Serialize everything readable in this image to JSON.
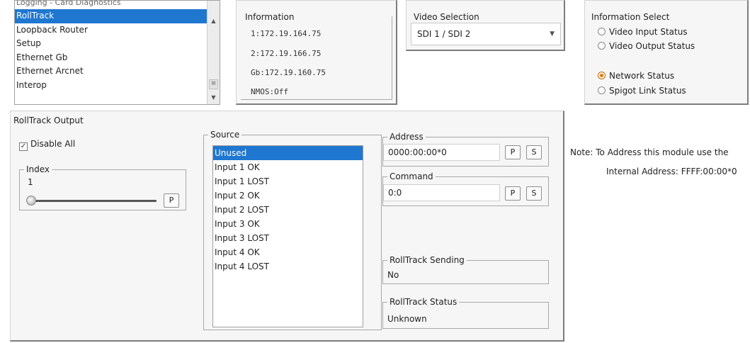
{
  "top_list": {
    "items": [
      {
        "label": "Logging - Card Diagnostics",
        "state": "cut"
      },
      {
        "label": "RollTrack",
        "state": "selected"
      },
      {
        "label": "Loopback Router",
        "state": ""
      },
      {
        "label": "Setup",
        "state": ""
      },
      {
        "label": "Ethernet Gb",
        "state": ""
      },
      {
        "label": "Ethernet Arcnet",
        "state": ""
      },
      {
        "label": "Interop",
        "state": ""
      }
    ],
    "scroll_up": "▲",
    "scroll_down": "▼",
    "grip": "≡"
  },
  "information": {
    "title": "Information",
    "lines": [
      "1:172.19.164.75",
      "2:172.19.166.75",
      "Gb:172.19.160.75",
      "NMOS:Off"
    ]
  },
  "video_selection": {
    "title": "Video Selection",
    "value": "SDI 1 / SDI 2",
    "caret": "▼"
  },
  "information_select": {
    "title": "Information Select",
    "options": [
      {
        "label": "Video Input Status",
        "selected": false
      },
      {
        "label": "Video Output Status",
        "selected": false
      },
      {
        "label": "Network Status",
        "selected": true
      },
      {
        "label": "Spigot Link Status",
        "selected": false
      }
    ]
  },
  "rolltrack_output": {
    "title": "RollTrack Output",
    "disable_all": {
      "label": "Disable All",
      "checked": true,
      "mark": "✓"
    },
    "index": {
      "title": "Index",
      "value": "1",
      "button": "P"
    },
    "source": {
      "title": "Source",
      "items": [
        "Unused",
        "Input 1 OK",
        "Input 1 LOST",
        "Input 2 OK",
        "Input 2 LOST",
        "Input 3 OK",
        "Input 3 LOST",
        "Input 4 OK",
        "Input 4 LOST"
      ],
      "selected_index": 0
    },
    "address": {
      "title": "Address",
      "value": "0000:00:00*0",
      "btn_p": "P",
      "btn_s": "S"
    },
    "command": {
      "title": "Command",
      "value": "0:0",
      "btn_p": "P",
      "btn_s": "S"
    },
    "sending": {
      "title": "RollTrack Sending",
      "value": "No"
    },
    "status": {
      "title": "RollTrack Status",
      "value": "Unknown"
    }
  },
  "note": {
    "line1": "Note: To Address this module use the",
    "line2": "Internal Address: FFFF:00:00*0"
  },
  "colors": {
    "selection": "#1f77d0",
    "radio_on": "#e07b00",
    "panel_bg": "#f6f6f6"
  }
}
